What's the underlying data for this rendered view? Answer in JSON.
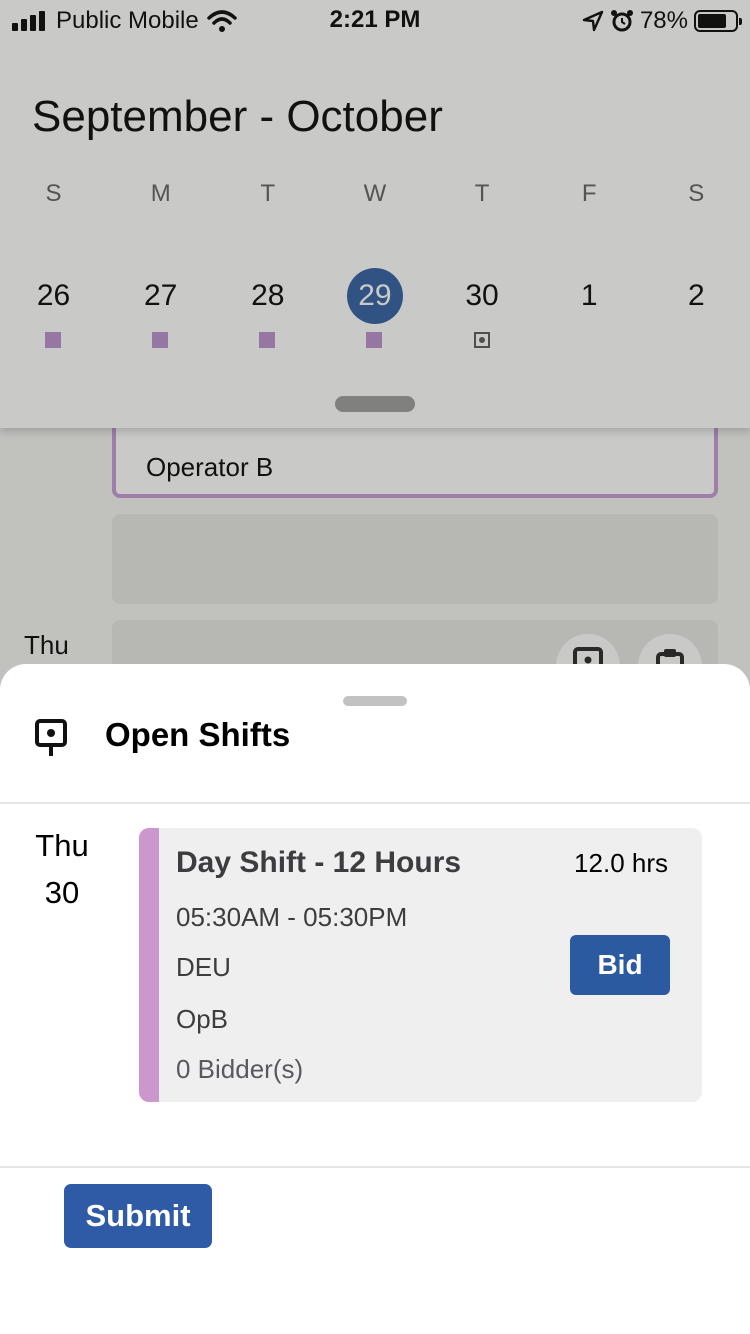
{
  "status_bar": {
    "carrier": "Public Mobile",
    "time": "2:21 PM",
    "battery_percent": "78%",
    "battery_level": 0.78,
    "icons": [
      "signal-icon",
      "wifi-icon",
      "location-icon",
      "alarm-icon",
      "battery-icon"
    ]
  },
  "calendar": {
    "title": "September - October",
    "weekdays": [
      "S",
      "M",
      "T",
      "W",
      "T",
      "F",
      "S"
    ],
    "dates": [
      {
        "day": "26",
        "marker": "shift"
      },
      {
        "day": "27",
        "marker": "shift"
      },
      {
        "day": "28",
        "marker": "shift"
      },
      {
        "day": "29",
        "marker": "shift",
        "selected": true
      },
      {
        "day": "30",
        "marker": "open-shift"
      },
      {
        "day": "1",
        "marker": null
      },
      {
        "day": "2",
        "marker": null
      }
    ],
    "selected_color": "#2c5aa0",
    "shift_marker_color": "#b98ccd"
  },
  "background": {
    "operator_card_label": "Operator B",
    "day_label": "Thu"
  },
  "sheet": {
    "title": "Open Shifts",
    "title_icon": "open-shift-icon",
    "day_name": "Thu",
    "day_number": "30",
    "shift": {
      "name": "Day Shift - 12 Hours",
      "hours": "12.0 hrs",
      "time_range": "05:30AM - 05:30PM",
      "department": "DEU",
      "position": "OpB",
      "bidders": "0 Bidder(s)",
      "bid_label": "Bid",
      "accent_color": "#cb97cc"
    },
    "submit_label": "Submit",
    "button_color": "#2c5aa0"
  }
}
